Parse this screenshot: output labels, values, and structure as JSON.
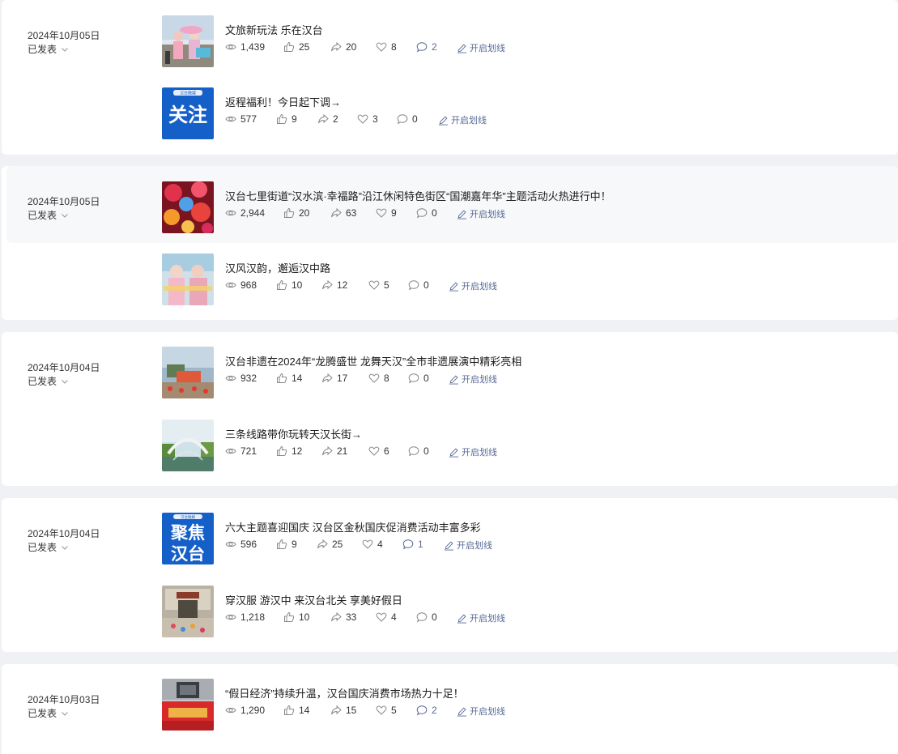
{
  "groups": [
    {
      "date": "2024年10月05日",
      "status": "已发表",
      "articles": [
        {
          "title": "文旅新玩法 乐在汉台",
          "views": "1,439",
          "likes": "25",
          "shares": "20",
          "favorites": "8",
          "comments": "2",
          "action": "开启划线",
          "comments_highlight": true
        },
        {
          "title": "返程福利！今日起下调→",
          "views": "577",
          "likes": "9",
          "shares": "2",
          "favorites": "3",
          "comments": "0",
          "action": "开启划线",
          "thumb_text": "关注",
          "thumb_badge": "汉台融媒"
        }
      ]
    },
    {
      "date": "2024年10月05日",
      "status": "已发表",
      "articles": [
        {
          "title": "汉台七里街道“汉水滨·幸福路”沿江休闲特色街区“国潮嘉年华”主题活动火热进行中！",
          "views": "2,944",
          "likes": "20",
          "shares": "63",
          "favorites": "9",
          "comments": "0",
          "action": "开启划线"
        },
        {
          "title": "汉风汉韵，邂逅汉中路",
          "views": "968",
          "likes": "10",
          "shares": "12",
          "favorites": "5",
          "comments": "0",
          "action": "开启划线"
        }
      ]
    },
    {
      "date": "2024年10月04日",
      "status": "已发表",
      "articles": [
        {
          "title": "汉台非遗在2024年“龙腾盛世 龙舞天汉”全市非遗展演中精彩亮相",
          "views": "932",
          "likes": "14",
          "shares": "17",
          "favorites": "8",
          "comments": "0",
          "action": "开启划线"
        },
        {
          "title": "三条线路带你玩转天汉长街→",
          "views": "721",
          "likes": "12",
          "shares": "21",
          "favorites": "6",
          "comments": "0",
          "action": "开启划线"
        }
      ]
    },
    {
      "date": "2024年10月04日",
      "status": "已发表",
      "articles": [
        {
          "title": "六大主题喜迎国庆 汉台区金秋国庆促消费活动丰富多彩",
          "views": "596",
          "likes": "9",
          "shares": "25",
          "favorites": "4",
          "comments": "1",
          "action": "开启划线",
          "comments_highlight": true,
          "thumb_text_line1": "聚焦",
          "thumb_text_line2": "汉台",
          "thumb_badge": "汉台融媒"
        },
        {
          "title": "穿汉服 游汉中 来汉台北关 享美好假日",
          "views": "1,218",
          "likes": "10",
          "shares": "33",
          "favorites": "4",
          "comments": "0",
          "action": "开启划线"
        }
      ]
    },
    {
      "date": "2024年10月03日",
      "status": "已发表",
      "articles": [
        {
          "title": "“假日经济”持续升温，汉台国庆消费市场热力十足！",
          "views": "1,290",
          "likes": "14",
          "shares": "15",
          "favorites": "5",
          "comments": "2",
          "action": "开启划线",
          "comments_highlight": true
        }
      ]
    }
  ],
  "icons": {
    "views": "eye-icon",
    "likes": "thumbs-up-icon",
    "shares": "share-arrow-icon",
    "favorites": "heart-icon",
    "comments": "comment-bubble-icon",
    "action": "pen-icon",
    "status": "chevron-down-icon"
  },
  "colors": {
    "link": "#576b95",
    "page_bg": "#f0f1f4",
    "card_bg": "#ffffff",
    "hover_bg": "#f7f8fa"
  }
}
